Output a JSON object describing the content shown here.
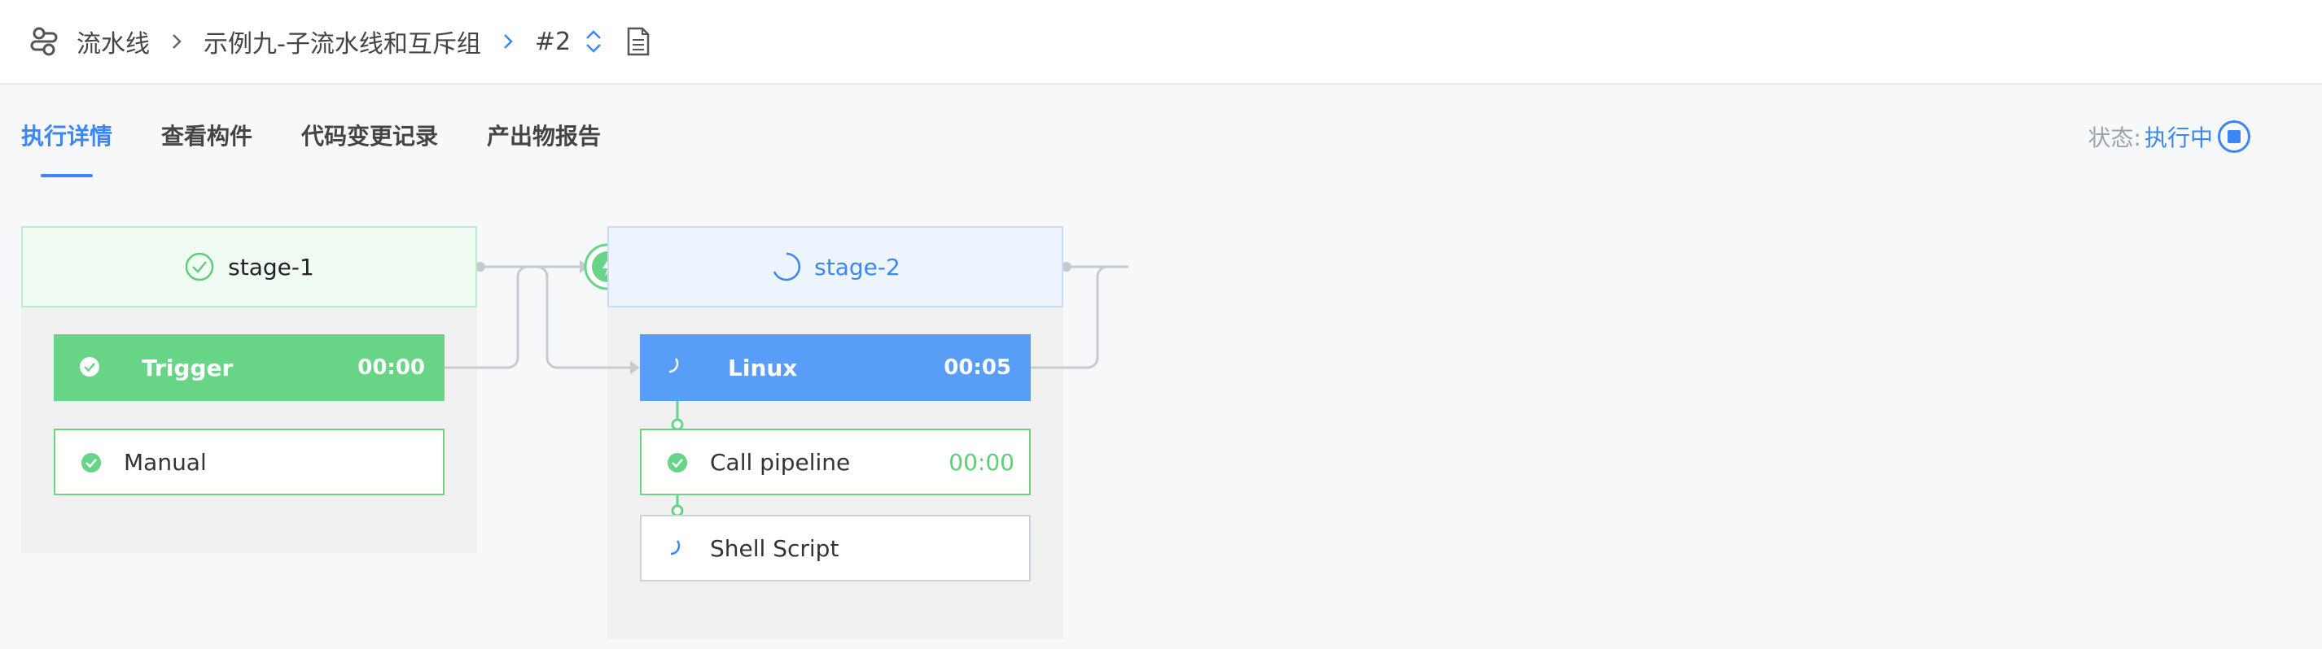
{
  "breadcrumb": {
    "root": "流水线",
    "pipeline": "示例九-子流水线和互斥组",
    "build": "#2"
  },
  "tabs": [
    {
      "label": "执行详情",
      "active": true
    },
    {
      "label": "查看构件",
      "active": false
    },
    {
      "label": "代码变更记录",
      "active": false
    },
    {
      "label": "产出物报告",
      "active": false
    }
  ],
  "status": {
    "label": "状态:",
    "value": "执行中"
  },
  "stages": [
    {
      "name": "stage-1",
      "state": "success",
      "jobs": [
        {
          "name": "Trigger",
          "time": "00:00",
          "state": "success"
        }
      ],
      "tasks": [
        {
          "name": "Manual",
          "time": "",
          "state": "success"
        }
      ]
    },
    {
      "name": "stage-2",
      "state": "running",
      "jobs": [
        {
          "name": "Linux",
          "time": "00:05",
          "state": "running"
        }
      ],
      "tasks": [
        {
          "name": "Call pipeline",
          "time": "00:00",
          "state": "success"
        },
        {
          "name": "Shell Script",
          "time": "",
          "state": "running"
        }
      ]
    }
  ],
  "colors": {
    "primary": "#3c87f5",
    "success": "#68d486",
    "running": "#589ef8",
    "muted": "#9aa3b2"
  },
  "icons": {
    "logo": "pipeline-icon",
    "separator": "chevron-right-icon",
    "build_switch": "up-down-chevron-icon",
    "log": "document-icon",
    "stop": "stop-icon",
    "stage_trigger": "lightning-icon",
    "success": "check-circle-icon",
    "running": "spinner-icon"
  }
}
